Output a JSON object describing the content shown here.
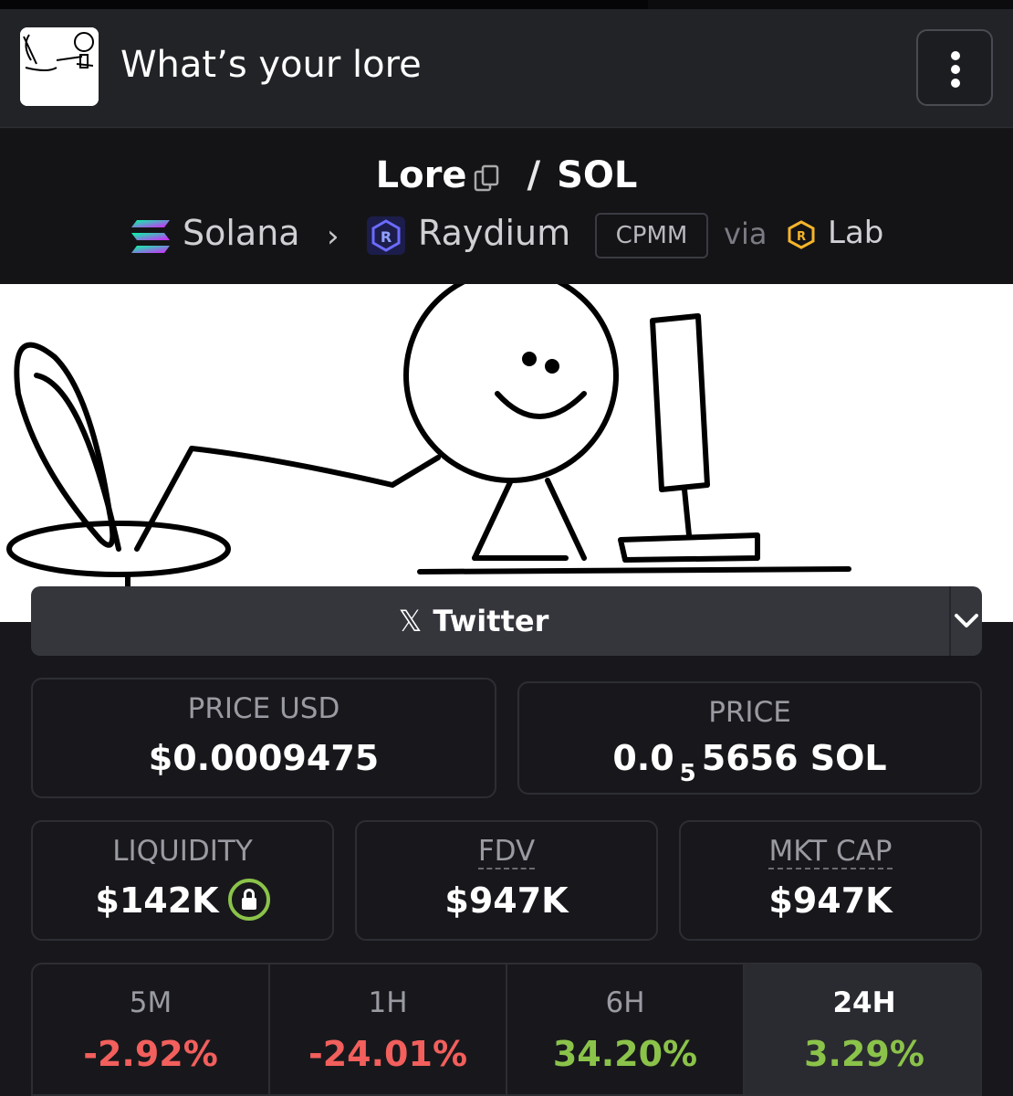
{
  "header": {
    "token_name": "What’s your lore",
    "avatar_icon": "stick-figure-computer-avatar",
    "menu_icon": "more-vertical-icon"
  },
  "pair": {
    "base": "Lore",
    "separator": "/",
    "quote": "SOL",
    "copy_icon": "copy-icon"
  },
  "chain": {
    "chain_name": "Solana",
    "dex_name": "Raydium",
    "pool_type": "CPMM",
    "via_label": "via",
    "launchpad": "Lab"
  },
  "social": {
    "twitter_label": "Twitter",
    "x_glyph": "𝕏"
  },
  "stats": {
    "price_usd_label": "PRICE USD",
    "price_usd_value": "$0.0009475",
    "price_label": "PRICE",
    "price_value_prefix": "0.0",
    "price_value_subscript": "5",
    "price_value_suffix": "5656 SOL",
    "liquidity_label": "LIQUIDITY",
    "liquidity_value": "$142K",
    "fdv_label": "FDV",
    "fdv_value": "$947K",
    "mktcap_label": "MKT CAP",
    "mktcap_value": "$947K"
  },
  "changes": [
    {
      "tf": "5M",
      "pct": "-2.92%"
    },
    {
      "tf": "1H",
      "pct": "-24.01%"
    },
    {
      "tf": "6H",
      "pct": "34.20%"
    },
    {
      "tf": "24H",
      "pct": "3.29%"
    }
  ],
  "colors": {
    "negative": "#f25f5c",
    "positive": "#8bc34a",
    "background": "#18181c",
    "lock_ring": "#8bc34a"
  }
}
